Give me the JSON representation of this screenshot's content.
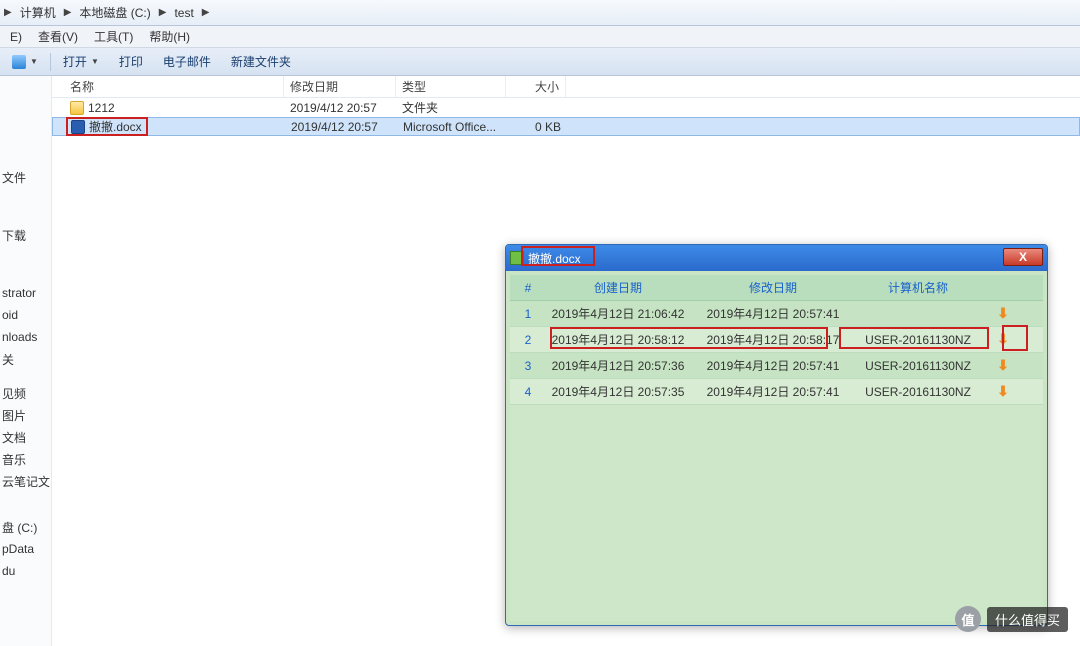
{
  "breadcrumb": {
    "items": [
      "计算机",
      "本地磁盘 (C:)",
      "test"
    ]
  },
  "menubar": {
    "items": [
      "E)",
      "查看(V)",
      "工具(T)",
      "帮助(H)"
    ]
  },
  "toolbar": {
    "open": "打开",
    "print": "打印",
    "email": "电子邮件",
    "newfolder": "新建文件夹"
  },
  "filelist": {
    "headers": {
      "name": "名称",
      "date": "修改日期",
      "type": "类型",
      "size": "大小"
    },
    "rows": [
      {
        "name": "1212",
        "date": "2019/4/12 20:57",
        "type": "文件夹",
        "size": "",
        "icon": "folder",
        "selected": false
      },
      {
        "name": "撤撤.docx",
        "date": "2019/4/12 20:57",
        "type": "Microsoft Office...",
        "size": "0 KB",
        "icon": "docx",
        "selected": true
      }
    ]
  },
  "sidebar": {
    "items": [
      "文件",
      "",
      "下载",
      "",
      "strator",
      "oid",
      "nloads",
      "关",
      "",
      "见频",
      "图片",
      "文档",
      "音乐",
      "云笔记文",
      "",
      "盘 (C:)",
      "pData",
      "du"
    ]
  },
  "dialog": {
    "title": "撤撤.docx",
    "close": "X",
    "headers": {
      "num": "#",
      "cdate": "创建日期",
      "mdate": "修改日期",
      "pc": "计算机名称"
    },
    "rows": [
      {
        "num": "1",
        "cdate": "2019年4月12日 21:06:42",
        "mdate": "2019年4月12日 20:57:41",
        "pc": ""
      },
      {
        "num": "2",
        "cdate": "2019年4月12日 20:58:12",
        "mdate": "2019年4月12日 20:58:17",
        "pc": "USER-20161130NZ"
      },
      {
        "num": "3",
        "cdate": "2019年4月12日 20:57:36",
        "mdate": "2019年4月12日 20:57:41",
        "pc": "USER-20161130NZ"
      },
      {
        "num": "4",
        "cdate": "2019年4月12日 20:57:35",
        "mdate": "2019年4月12日 20:57:41",
        "pc": "USER-20161130NZ"
      }
    ]
  },
  "watermark": {
    "badge": "值",
    "text": "什么值得买"
  }
}
